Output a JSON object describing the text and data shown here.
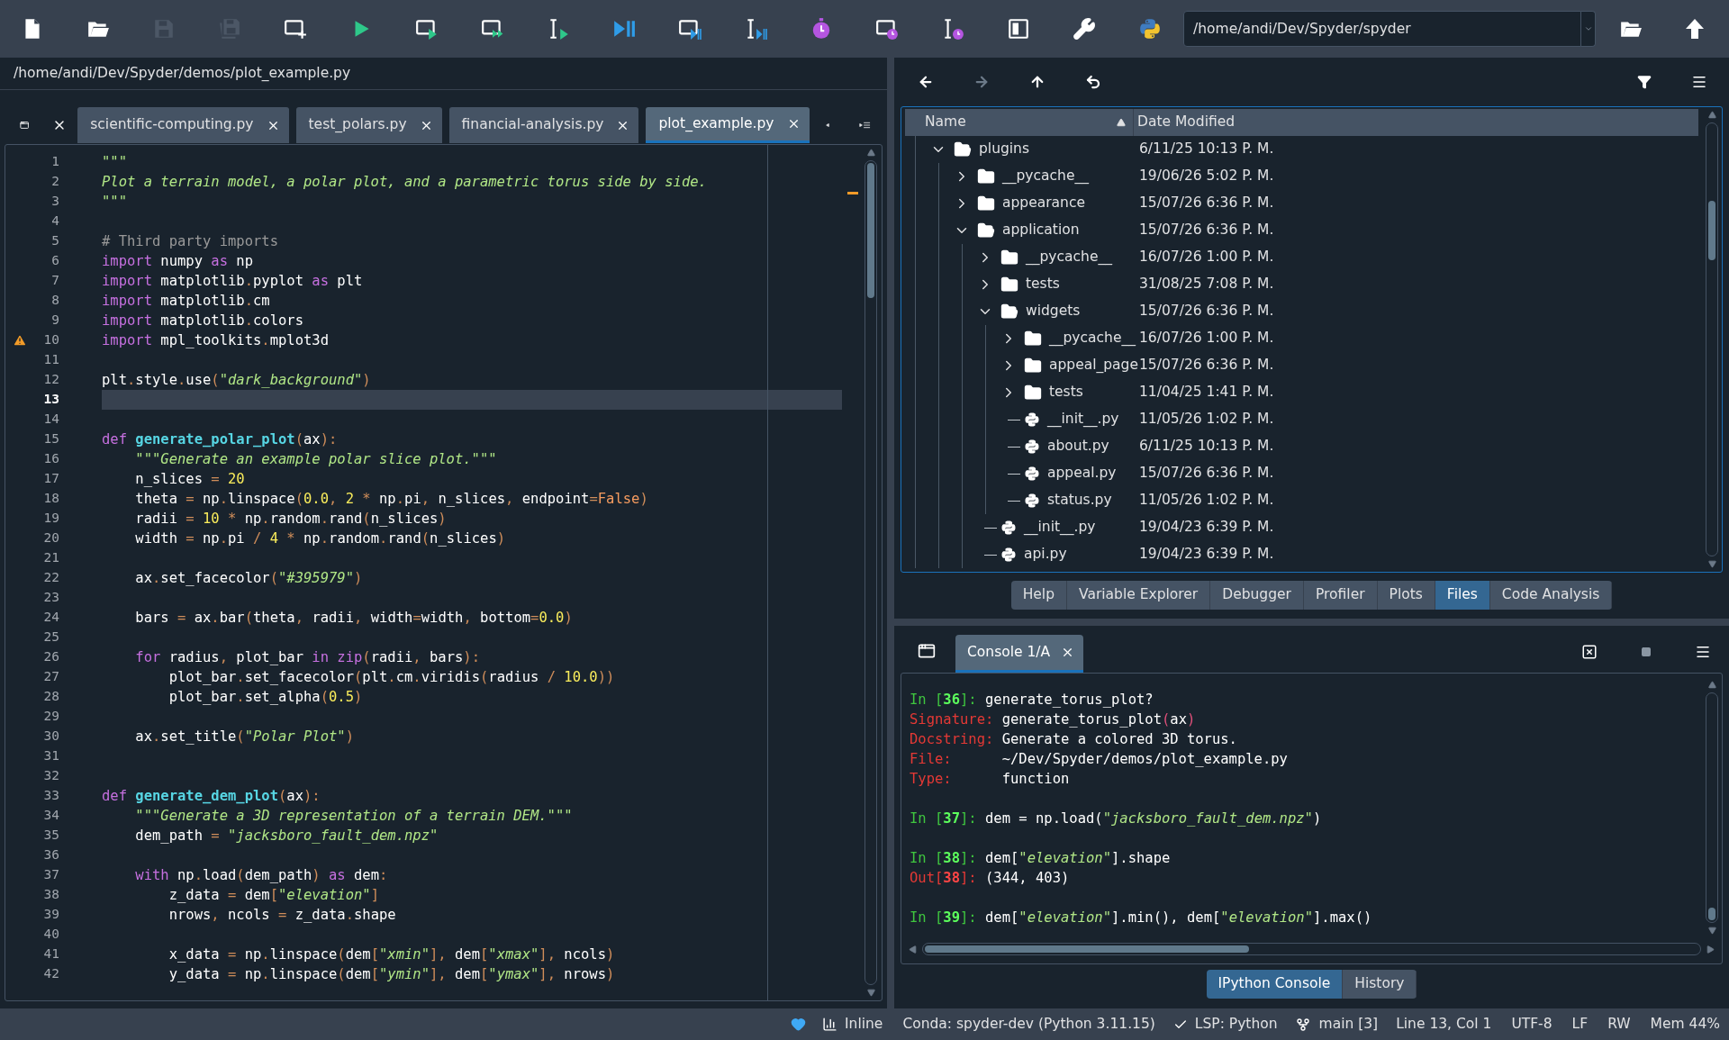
{
  "toolbar": {
    "buttons": [
      {
        "kind": "new-file",
        "disabled": false
      },
      {
        "kind": "open",
        "disabled": false
      },
      {
        "kind": "save",
        "disabled": true
      },
      {
        "kind": "save-all",
        "disabled": true
      },
      {
        "kind": "new-cell",
        "disabled": false
      },
      {
        "kind": "run",
        "disabled": false
      },
      {
        "kind": "run-cell",
        "disabled": false
      },
      {
        "kind": "run-cell-advance",
        "disabled": false
      },
      {
        "kind": "run-selection",
        "disabled": false
      },
      {
        "kind": "debug",
        "disabled": false
      },
      {
        "kind": "debug-cell",
        "disabled": false
      },
      {
        "kind": "debug-selection",
        "disabled": false
      },
      {
        "kind": "profile",
        "disabled": false
      },
      {
        "kind": "profile-cell",
        "disabled": false
      },
      {
        "kind": "profile-selection",
        "disabled": false
      },
      {
        "kind": "maximize",
        "disabled": false
      },
      {
        "kind": "preferences",
        "disabled": false
      },
      {
        "kind": "pythonpath",
        "disabled": false
      }
    ],
    "working_directory": "/home/andi/Dev/Spyder/spyder"
  },
  "editor": {
    "path": "/home/andi/Dev/Spyder/demos/plot_example.py",
    "tabs": [
      {
        "label": "scientific-computing.py",
        "selected": false
      },
      {
        "label": "test_polars.py",
        "selected": false
      },
      {
        "label": "financial-analysis.py",
        "selected": false
      },
      {
        "label": "plot_example.py",
        "selected": true
      }
    ],
    "lines": [
      {
        "number": "1",
        "current": false,
        "warning": false,
        "tokens": [
          {
            "kind": "d",
            "text": "\"\"\""
          }
        ]
      },
      {
        "number": "2",
        "current": false,
        "warning": false,
        "tokens": [
          {
            "kind": "d",
            "text": "Plot a terrain model, a polar plot, and a parametric torus side by side."
          }
        ]
      },
      {
        "number": "3",
        "current": false,
        "warning": false,
        "tokens": [
          {
            "kind": "d",
            "text": "\"\"\""
          }
        ]
      },
      {
        "number": "4",
        "current": false,
        "warning": false
      },
      {
        "number": "5",
        "current": false,
        "warning": false,
        "tokens": [
          {
            "kind": "c",
            "text": "# Third party imports"
          }
        ]
      },
      {
        "number": "6",
        "current": false,
        "warning": false,
        "tokens": [
          {
            "kind": "k",
            "text": "import"
          },
          {
            "kind": "t",
            "text": " numpy "
          },
          {
            "kind": "k",
            "text": "as"
          },
          {
            "kind": "t",
            "text": " np"
          }
        ]
      },
      {
        "number": "7",
        "current": false,
        "warning": false,
        "tokens": [
          {
            "kind": "k",
            "text": "import"
          },
          {
            "kind": "t",
            "text": " matplotlib"
          },
          {
            "kind": "o",
            "text": "."
          },
          {
            "kind": "t",
            "text": "pyplot "
          },
          {
            "kind": "k",
            "text": "as"
          },
          {
            "kind": "t",
            "text": " plt"
          }
        ]
      },
      {
        "number": "8",
        "current": false,
        "warning": false,
        "tokens": [
          {
            "kind": "k",
            "text": "import"
          },
          {
            "kind": "t",
            "text": " matplotlib"
          },
          {
            "kind": "o",
            "text": "."
          },
          {
            "kind": "t",
            "text": "cm"
          }
        ]
      },
      {
        "number": "9",
        "current": false,
        "warning": false,
        "tokens": [
          {
            "kind": "k",
            "text": "import"
          },
          {
            "kind": "t",
            "text": " matplotlib"
          },
          {
            "kind": "o",
            "text": "."
          },
          {
            "kind": "t",
            "text": "colors"
          }
        ]
      },
      {
        "number": "10",
        "current": false,
        "warning": true,
        "tokens": [
          {
            "kind": "k",
            "text": "import"
          },
          {
            "kind": "t",
            "text": " mpl_toolkits"
          },
          {
            "kind": "o",
            "text": "."
          },
          {
            "kind": "t",
            "text": "mplot3d"
          }
        ]
      },
      {
        "number": "11",
        "current": false,
        "warning": false
      },
      {
        "number": "12",
        "current": false,
        "warning": false,
        "tokens": [
          {
            "kind": "t",
            "text": "plt"
          },
          {
            "kind": "o",
            "text": "."
          },
          {
            "kind": "t",
            "text": "style"
          },
          {
            "kind": "o",
            "text": "."
          },
          {
            "kind": "t",
            "text": "use"
          },
          {
            "kind": "o",
            "text": "("
          },
          {
            "kind": "s",
            "text": "\"dark_background\""
          },
          {
            "kind": "o",
            "text": ")"
          }
        ]
      },
      {
        "number": "13",
        "current": true,
        "warning": false
      },
      {
        "number": "14",
        "current": false,
        "warning": false
      },
      {
        "number": "15",
        "current": false,
        "warning": false,
        "tokens": [
          {
            "kind": "k",
            "text": "def "
          },
          {
            "kind": "f",
            "text": "generate_polar_plot"
          },
          {
            "kind": "o",
            "text": "("
          },
          {
            "kind": "t",
            "text": "ax"
          },
          {
            "kind": "o",
            "text": "):"
          }
        ]
      },
      {
        "number": "16",
        "current": false,
        "warning": false,
        "tokens": [
          {
            "kind": "d",
            "text": "    \"\"\"Generate an example polar slice plot.\"\"\""
          }
        ]
      },
      {
        "number": "17",
        "current": false,
        "warning": false,
        "tokens": [
          {
            "kind": "t",
            "text": "    n_slices "
          },
          {
            "kind": "o",
            "text": "= "
          },
          {
            "kind": "n",
            "text": "20"
          }
        ]
      },
      {
        "number": "18",
        "current": false,
        "warning": false,
        "tokens": [
          {
            "kind": "t",
            "text": "    theta "
          },
          {
            "kind": "o",
            "text": "="
          },
          {
            "kind": "t",
            "text": " np"
          },
          {
            "kind": "o",
            "text": "."
          },
          {
            "kind": "t",
            "text": "linspace"
          },
          {
            "kind": "o",
            "text": "("
          },
          {
            "kind": "n",
            "text": "0.0"
          },
          {
            "kind": "o",
            "text": ", "
          },
          {
            "kind": "n",
            "text": "2 "
          },
          {
            "kind": "o",
            "text": "*"
          },
          {
            "kind": "t",
            "text": " np"
          },
          {
            "kind": "o",
            "text": "."
          },
          {
            "kind": "t",
            "text": "pi"
          },
          {
            "kind": "o",
            "text": ","
          },
          {
            "kind": "t",
            "text": " n_slices"
          },
          {
            "kind": "o",
            "text": ","
          },
          {
            "kind": "t",
            "text": " endpoint"
          },
          {
            "kind": "o",
            "text": "="
          },
          {
            "kind": "b",
            "text": "False"
          },
          {
            "kind": "o",
            "text": ")"
          }
        ]
      },
      {
        "number": "19",
        "current": false,
        "warning": false,
        "tokens": [
          {
            "kind": "t",
            "text": "    radii "
          },
          {
            "kind": "o",
            "text": "= "
          },
          {
            "kind": "n",
            "text": "10 "
          },
          {
            "kind": "o",
            "text": "*"
          },
          {
            "kind": "t",
            "text": " np"
          },
          {
            "kind": "o",
            "text": "."
          },
          {
            "kind": "t",
            "text": "random"
          },
          {
            "kind": "o",
            "text": "."
          },
          {
            "kind": "t",
            "text": "rand"
          },
          {
            "kind": "o",
            "text": "("
          },
          {
            "kind": "t",
            "text": "n_slices"
          },
          {
            "kind": "o",
            "text": ")"
          }
        ]
      },
      {
        "number": "20",
        "current": false,
        "warning": false,
        "tokens": [
          {
            "kind": "t",
            "text": "    width "
          },
          {
            "kind": "o",
            "text": "="
          },
          {
            "kind": "t",
            "text": " np"
          },
          {
            "kind": "o",
            "text": "."
          },
          {
            "kind": "t",
            "text": "pi "
          },
          {
            "kind": "o",
            "text": "/ "
          },
          {
            "kind": "n",
            "text": "4 "
          },
          {
            "kind": "o",
            "text": "*"
          },
          {
            "kind": "t",
            "text": " np"
          },
          {
            "kind": "o",
            "text": "."
          },
          {
            "kind": "t",
            "text": "random"
          },
          {
            "kind": "o",
            "text": "."
          },
          {
            "kind": "t",
            "text": "rand"
          },
          {
            "kind": "o",
            "text": "("
          },
          {
            "kind": "t",
            "text": "n_slices"
          },
          {
            "kind": "o",
            "text": ")"
          }
        ]
      },
      {
        "number": "21",
        "current": false,
        "warning": false
      },
      {
        "number": "22",
        "current": false,
        "warning": false,
        "tokens": [
          {
            "kind": "t",
            "text": "    ax"
          },
          {
            "kind": "o",
            "text": "."
          },
          {
            "kind": "t",
            "text": "set_facecolor"
          },
          {
            "kind": "o",
            "text": "("
          },
          {
            "kind": "s",
            "text": "\"#395979\""
          },
          {
            "kind": "o",
            "text": ")"
          }
        ]
      },
      {
        "number": "23",
        "current": false,
        "warning": false
      },
      {
        "number": "24",
        "current": false,
        "warning": false,
        "tokens": [
          {
            "kind": "t",
            "text": "    bars "
          },
          {
            "kind": "o",
            "text": "="
          },
          {
            "kind": "t",
            "text": " ax"
          },
          {
            "kind": "o",
            "text": "."
          },
          {
            "kind": "t",
            "text": "bar"
          },
          {
            "kind": "o",
            "text": "("
          },
          {
            "kind": "t",
            "text": "theta"
          },
          {
            "kind": "o",
            "text": ","
          },
          {
            "kind": "t",
            "text": " radii"
          },
          {
            "kind": "o",
            "text": ","
          },
          {
            "kind": "t",
            "text": " width"
          },
          {
            "kind": "o",
            "text": "="
          },
          {
            "kind": "t",
            "text": "width"
          },
          {
            "kind": "o",
            "text": ","
          },
          {
            "kind": "t",
            "text": " bottom"
          },
          {
            "kind": "o",
            "text": "="
          },
          {
            "kind": "n",
            "text": "0.0"
          },
          {
            "kind": "o",
            "text": ")"
          }
        ]
      },
      {
        "number": "25",
        "current": false,
        "warning": false
      },
      {
        "number": "26",
        "current": false,
        "warning": false,
        "tokens": [
          {
            "kind": "k",
            "text": "    for"
          },
          {
            "kind": "t",
            "text": " radius"
          },
          {
            "kind": "o",
            "text": ","
          },
          {
            "kind": "t",
            "text": " plot_bar "
          },
          {
            "kind": "k",
            "text": "in zip"
          },
          {
            "kind": "o",
            "text": "("
          },
          {
            "kind": "t",
            "text": "radii"
          },
          {
            "kind": "o",
            "text": ","
          },
          {
            "kind": "t",
            "text": " bars"
          },
          {
            "kind": "o",
            "text": "):"
          }
        ]
      },
      {
        "number": "27",
        "current": false,
        "warning": false,
        "tokens": [
          {
            "kind": "t",
            "text": "        plot_bar"
          },
          {
            "kind": "o",
            "text": "."
          },
          {
            "kind": "t",
            "text": "set_facecolor"
          },
          {
            "kind": "o",
            "text": "("
          },
          {
            "kind": "t",
            "text": "plt"
          },
          {
            "kind": "o",
            "text": "."
          },
          {
            "kind": "t",
            "text": "cm"
          },
          {
            "kind": "o",
            "text": "."
          },
          {
            "kind": "t",
            "text": "viridis"
          },
          {
            "kind": "o",
            "text": "("
          },
          {
            "kind": "t",
            "text": "radius "
          },
          {
            "kind": "o",
            "text": "/ "
          },
          {
            "kind": "n",
            "text": "10.0"
          },
          {
            "kind": "o",
            "text": "))"
          }
        ]
      },
      {
        "number": "28",
        "current": false,
        "warning": false,
        "tokens": [
          {
            "kind": "t",
            "text": "        plot_bar"
          },
          {
            "kind": "o",
            "text": "."
          },
          {
            "kind": "t",
            "text": "set_alpha"
          },
          {
            "kind": "o",
            "text": "("
          },
          {
            "kind": "n",
            "text": "0.5"
          },
          {
            "kind": "o",
            "text": ")"
          }
        ]
      },
      {
        "number": "29",
        "current": false,
        "warning": false
      },
      {
        "number": "30",
        "current": false,
        "warning": false,
        "tokens": [
          {
            "kind": "t",
            "text": "    ax"
          },
          {
            "kind": "o",
            "text": "."
          },
          {
            "kind": "t",
            "text": "set_title"
          },
          {
            "kind": "o",
            "text": "("
          },
          {
            "kind": "s",
            "text": "\"Polar Plot\""
          },
          {
            "kind": "o",
            "text": ")"
          }
        ]
      },
      {
        "number": "31",
        "current": false,
        "warning": false
      },
      {
        "number": "32",
        "current": false,
        "warning": false
      },
      {
        "number": "33",
        "current": false,
        "warning": false,
        "tokens": [
          {
            "kind": "k",
            "text": "def "
          },
          {
            "kind": "f",
            "text": "generate_dem_plot"
          },
          {
            "kind": "o",
            "text": "("
          },
          {
            "kind": "t",
            "text": "ax"
          },
          {
            "kind": "o",
            "text": "):"
          }
        ]
      },
      {
        "number": "34",
        "current": false,
        "warning": false,
        "tokens": [
          {
            "kind": "d",
            "text": "    \"\"\"Generate a 3D representation of a terrain DEM.\"\"\""
          }
        ]
      },
      {
        "number": "35",
        "current": false,
        "warning": false,
        "tokens": [
          {
            "kind": "t",
            "text": "    dem_path "
          },
          {
            "kind": "o",
            "text": "= "
          },
          {
            "kind": "s",
            "text": "\"jacksboro_fault_dem.npz\""
          }
        ]
      },
      {
        "number": "36",
        "current": false,
        "warning": false
      },
      {
        "number": "37",
        "current": false,
        "warning": false,
        "tokens": [
          {
            "kind": "k",
            "text": "    with"
          },
          {
            "kind": "t",
            "text": " np"
          },
          {
            "kind": "o",
            "text": "."
          },
          {
            "kind": "t",
            "text": "load"
          },
          {
            "kind": "o",
            "text": "("
          },
          {
            "kind": "t",
            "text": "dem_path"
          },
          {
            "kind": "o",
            "text": ") "
          },
          {
            "kind": "k",
            "text": "as"
          },
          {
            "kind": "t",
            "text": " dem"
          },
          {
            "kind": "o",
            "text": ":"
          }
        ]
      },
      {
        "number": "38",
        "current": false,
        "warning": false,
        "tokens": [
          {
            "kind": "t",
            "text": "        z_data "
          },
          {
            "kind": "o",
            "text": "="
          },
          {
            "kind": "t",
            "text": " dem"
          },
          {
            "kind": "o",
            "text": "["
          },
          {
            "kind": "s",
            "text": "\"elevation\""
          },
          {
            "kind": "o",
            "text": "]"
          }
        ]
      },
      {
        "number": "39",
        "current": false,
        "warning": false,
        "tokens": [
          {
            "kind": "t",
            "text": "        nrows"
          },
          {
            "kind": "o",
            "text": ","
          },
          {
            "kind": "t",
            "text": " ncols "
          },
          {
            "kind": "o",
            "text": "="
          },
          {
            "kind": "t",
            "text": " z_data"
          },
          {
            "kind": "o",
            "text": "."
          },
          {
            "kind": "t",
            "text": "shape"
          }
        ]
      },
      {
        "number": "40",
        "current": false,
        "warning": false
      },
      {
        "number": "41",
        "current": false,
        "warning": false,
        "tokens": [
          {
            "kind": "t",
            "text": "        x_data "
          },
          {
            "kind": "o",
            "text": "="
          },
          {
            "kind": "t",
            "text": " np"
          },
          {
            "kind": "o",
            "text": "."
          },
          {
            "kind": "t",
            "text": "linspace"
          },
          {
            "kind": "o",
            "text": "("
          },
          {
            "kind": "t",
            "text": "dem"
          },
          {
            "kind": "o",
            "text": "["
          },
          {
            "kind": "s",
            "text": "\"xmin\""
          },
          {
            "kind": "o",
            "text": "],"
          },
          {
            "kind": "t",
            "text": " dem"
          },
          {
            "kind": "o",
            "text": "["
          },
          {
            "kind": "s",
            "text": "\"xmax\""
          },
          {
            "kind": "o",
            "text": "],"
          },
          {
            "kind": "t",
            "text": " ncols"
          },
          {
            "kind": "o",
            "text": ")"
          }
        ]
      },
      {
        "number": "42",
        "current": false,
        "warning": false,
        "tokens": [
          {
            "kind": "t",
            "text": "        y_data "
          },
          {
            "kind": "o",
            "text": "="
          },
          {
            "kind": "t",
            "text": " np"
          },
          {
            "kind": "o",
            "text": "."
          },
          {
            "kind": "t",
            "text": "linspace"
          },
          {
            "kind": "o",
            "text": "("
          },
          {
            "kind": "t",
            "text": "dem"
          },
          {
            "kind": "o",
            "text": "["
          },
          {
            "kind": "s",
            "text": "\"ymin\""
          },
          {
            "kind": "o",
            "text": "],"
          },
          {
            "kind": "t",
            "text": " dem"
          },
          {
            "kind": "o",
            "text": "["
          },
          {
            "kind": "s",
            "text": "\"ymax\""
          },
          {
            "kind": "o",
            "text": "],"
          },
          {
            "kind": "t",
            "text": " nrows"
          },
          {
            "kind": "o",
            "text": ")"
          }
        ]
      }
    ]
  },
  "files": {
    "columns": [
      "Name",
      "Date Modified"
    ],
    "tree": [
      {
        "name": "plugins",
        "date": "6/11/25 10:13 P. M.",
        "kind": "folder",
        "expanded": true,
        "children": [
          {
            "name": "__pycache__",
            "date": "19/06/26 5:02 P. M.",
            "kind": "folder",
            "expanded": false
          },
          {
            "name": "appearance",
            "date": "15/07/26 6:36 P. M.",
            "kind": "folder",
            "expanded": false
          },
          {
            "name": "application",
            "date": "15/07/26 6:36 P. M.",
            "kind": "folder",
            "expanded": true,
            "children": [
              {
                "name": "__pycache__",
                "date": "16/07/26 1:00 P. M.",
                "kind": "folder",
                "expanded": false
              },
              {
                "name": "tests",
                "date": "31/08/25 7:08 P. M.",
                "kind": "folder",
                "expanded": false
              },
              {
                "name": "widgets",
                "date": "15/07/26 6:36 P. M.",
                "kind": "folder",
                "expanded": true,
                "children": [
                  {
                    "name": "__pycache__",
                    "date": "16/07/26 1:00 P. M.",
                    "kind": "folder",
                    "expanded": false
                  },
                  {
                    "name": "appeal_page",
                    "date": "15/07/26 6:36 P. M.",
                    "kind": "folder",
                    "expanded": false
                  },
                  {
                    "name": "tests",
                    "date": "11/04/25 1:41 P. M.",
                    "kind": "folder",
                    "expanded": false
                  },
                  {
                    "name": "__init__.py",
                    "date": "11/05/26 1:02 P. M.",
                    "kind": "python"
                  },
                  {
                    "name": "about.py",
                    "date": "6/11/25 10:13 P. M.",
                    "kind": "python"
                  },
                  {
                    "name": "appeal.py",
                    "date": "15/07/26 6:36 P. M.",
                    "kind": "python"
                  },
                  {
                    "name": "status.py",
                    "date": "11/05/26 1:02 P. M.",
                    "kind": "python"
                  }
                ]
              },
              {
                "name": "__init__.py",
                "date": "19/04/23 6:39 P. M.",
                "kind": "python"
              },
              {
                "name": "api.py",
                "date": "19/04/23 6:39 P. M.",
                "kind": "python"
              }
            ]
          }
        ]
      }
    ]
  },
  "pane_tabs": [
    {
      "label": "Help",
      "selected": false
    },
    {
      "label": "Variable Explorer",
      "selected": false
    },
    {
      "label": "Debugger",
      "selected": false
    },
    {
      "label": "Profiler",
      "selected": false
    },
    {
      "label": "Plots",
      "selected": false
    },
    {
      "label": "Files",
      "selected": true
    },
    {
      "label": "Code Analysis",
      "selected": false
    }
  ],
  "console": {
    "tabs": [
      {
        "label": "Console 1/A",
        "selected": true
      }
    ],
    "lines": [
      {
        "kind": "code",
        "tokens": [
          {
            "kind": "in",
            "text": "In ["
          },
          {
            "kind": "inn",
            "text": "36"
          },
          {
            "kind": "in",
            "text": "]: "
          },
          {
            "kind": "t",
            "text": "generate_torus_plot?"
          }
        ]
      },
      {
        "kind": "code",
        "tokens": [
          {
            "kind": "lbl",
            "text": "Signature: "
          },
          {
            "kind": "t",
            "text": "generate_torus_plot"
          },
          {
            "kind": "p",
            "text": "("
          },
          {
            "kind": "t",
            "text": "ax"
          },
          {
            "kind": "p",
            "text": ")"
          }
        ]
      },
      {
        "kind": "code",
        "tokens": [
          {
            "kind": "lbl",
            "text": "Docstring: "
          },
          {
            "kind": "t",
            "text": "Generate a colored 3D torus."
          }
        ]
      },
      {
        "kind": "code",
        "tokens": [
          {
            "kind": "lbl",
            "text": "File:      "
          },
          {
            "kind": "t",
            "text": "~/Dev/Spyder/demos/plot_example.py"
          }
        ]
      },
      {
        "kind": "code",
        "tokens": [
          {
            "kind": "lbl",
            "text": "Type:      "
          },
          {
            "kind": "t",
            "text": "function"
          }
        ]
      },
      {
        "kind": "blank"
      },
      {
        "kind": "code",
        "tokens": [
          {
            "kind": "in",
            "text": "In ["
          },
          {
            "kind": "inn",
            "text": "37"
          },
          {
            "kind": "in",
            "text": "]: "
          },
          {
            "kind": "t",
            "text": "dem = np.load("
          },
          {
            "kind": "s",
            "text": "\"jacksboro_fault_dem.npz\""
          },
          {
            "kind": "t",
            "text": ")"
          }
        ]
      },
      {
        "kind": "blank"
      },
      {
        "kind": "code",
        "tokens": [
          {
            "kind": "in",
            "text": "In ["
          },
          {
            "kind": "inn",
            "text": "38"
          },
          {
            "kind": "in",
            "text": "]: "
          },
          {
            "kind": "t",
            "text": "dem["
          },
          {
            "kind": "s",
            "text": "\"elevation\""
          },
          {
            "kind": "t",
            "text": "].shape"
          }
        ]
      },
      {
        "kind": "code",
        "tokens": [
          {
            "kind": "out",
            "text": "Out["
          },
          {
            "kind": "outn",
            "text": "38"
          },
          {
            "kind": "out",
            "text": "]: "
          },
          {
            "kind": "t",
            "text": "(344, 403)"
          }
        ]
      },
      {
        "kind": "blank"
      },
      {
        "kind": "code",
        "tokens": [
          {
            "kind": "in",
            "text": "In ["
          },
          {
            "kind": "inn",
            "text": "39"
          },
          {
            "kind": "in",
            "text": "]: "
          },
          {
            "kind": "t",
            "text": "dem["
          },
          {
            "kind": "s",
            "text": "\"elevation\""
          },
          {
            "kind": "t",
            "text": "].min(), dem["
          },
          {
            "kind": "s",
            "text": "\"elevation\""
          },
          {
            "kind": "t",
            "text": "].max()"
          }
        ]
      }
    ],
    "bottom_tabs": [
      {
        "label": "IPython Console",
        "selected": true
      },
      {
        "label": "History",
        "selected": false
      }
    ]
  },
  "status_bar": {
    "inline": "Inline",
    "interpreter": "Conda: spyder-dev (Python 3.11.15)",
    "lsp": "LSP: Python",
    "branch": "main [3]",
    "cursor": "Line 13, Col 1",
    "encoding": "UTF-8",
    "eol": "LF",
    "permissions": "RW",
    "memory": "Mem 44%"
  }
}
